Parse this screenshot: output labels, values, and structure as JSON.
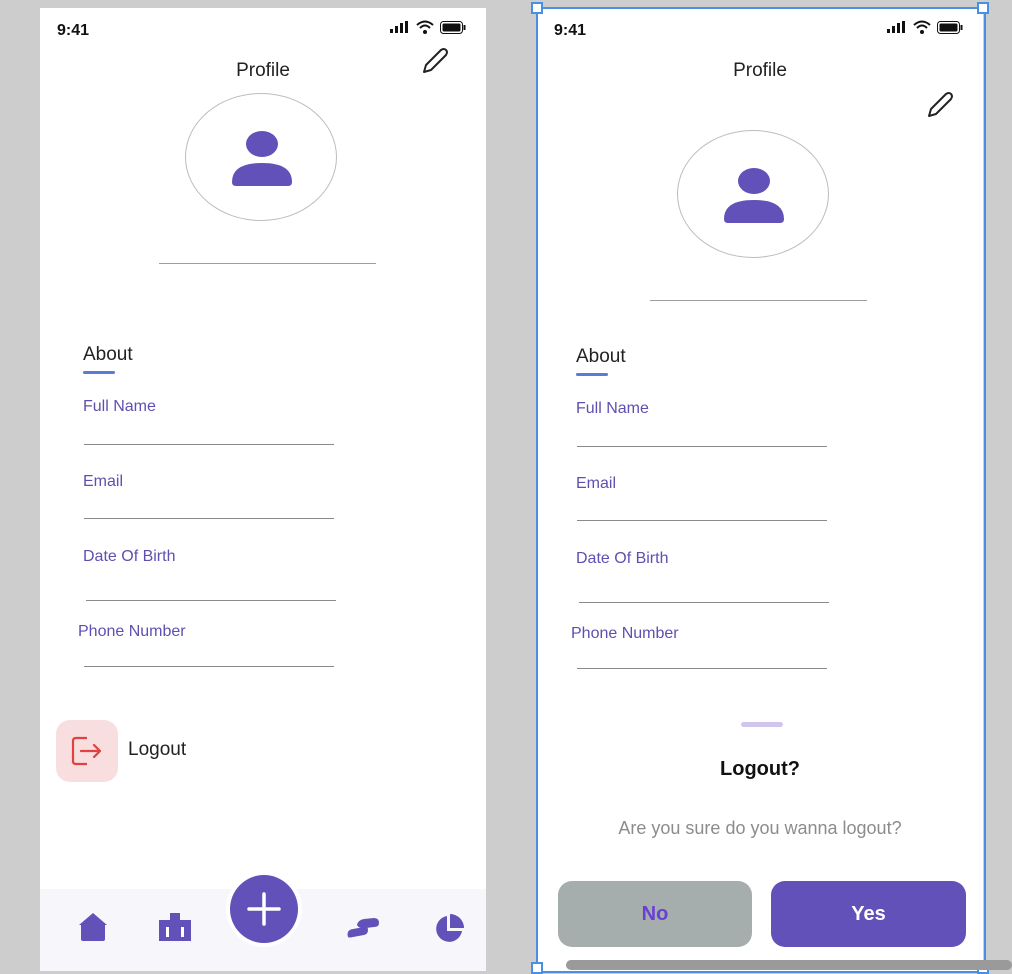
{
  "left_screen": {
    "status_time": "9:41",
    "title": "Profile",
    "about_heading": "About",
    "fields": [
      "Full Name",
      "Email",
      "Date Of Birth",
      "Phone Number"
    ],
    "logout_label": "Logout",
    "tabs": [
      "home-icon",
      "briefcase-icon",
      "add-icon",
      "transfer-icon",
      "pie-chart-icon"
    ]
  },
  "right_screen": {
    "status_time": "9:41",
    "title": "Profile",
    "about_heading": "About",
    "fields": [
      "Full Name",
      "Email",
      "Date Of Birth",
      "Phone Number"
    ],
    "dialog": {
      "title": "Logout?",
      "message": "Are you sure do you wanna logout?",
      "no_label": "No",
      "yes_label": "Yes"
    }
  },
  "colors": {
    "accent": "#6251b8",
    "label": "#5f4fb0",
    "logout_bg": "#f8dede",
    "logout_icon": "#e0433f",
    "no_button_bg": "#a6adad",
    "selection": "#4a90e2"
  }
}
